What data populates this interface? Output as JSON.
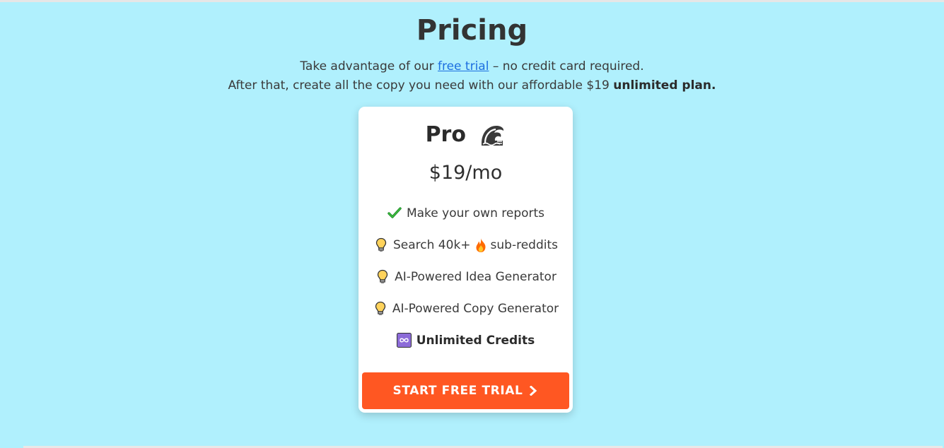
{
  "page": {
    "title": "Pricing",
    "subtitle": {
      "line1_prefix": "Take advantage of our ",
      "line1_link": "free trial",
      "line1_suffix": " – no credit card required.",
      "line2_prefix": "After that, create all the copy you need with our affordable $19 ",
      "line2_bold": "unlimited plan."
    }
  },
  "plan": {
    "name": "Pro",
    "name_icon": "water-wave-icon",
    "price": "$19/mo",
    "features": [
      {
        "icon": "check-mark-icon",
        "text": "Make your own reports"
      },
      {
        "icon": "light-bulb-icon",
        "text_before": "Search 40k+",
        "mid_icon": "fire-icon",
        "text_after": "sub-reddits"
      },
      {
        "icon": "light-bulb-icon",
        "text": "AI-Powered Idea Generator"
      },
      {
        "icon": "light-bulb-icon",
        "text": "AI-Powered Copy Generator"
      },
      {
        "icon": "infinity-icon",
        "text": "Unlimited Credits"
      }
    ],
    "cta_label": "START FREE TRIAL"
  },
  "colors": {
    "background": "#b0f0fd",
    "card": "#ffffff",
    "cta": "#ff5722",
    "link": "#1d6fe0"
  }
}
